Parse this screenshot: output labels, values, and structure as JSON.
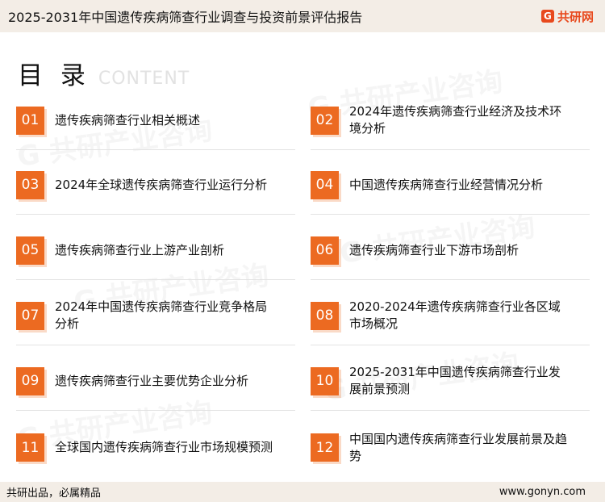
{
  "header": {
    "title": "2025-2031年中国遗传疾病筛查行业调查与投资前景评估报告",
    "brand_mark": "G",
    "brand_name": "共研网"
  },
  "toc": {
    "heading": "目 录",
    "heading_sub": "CONTENT",
    "items": [
      {
        "num": "01",
        "label": "遗传疾病筛查行业相关概述"
      },
      {
        "num": "02",
        "label": "2024年遗传疾病筛查行业经济及技术环境分析"
      },
      {
        "num": "03",
        "label": "2024年全球遗传疾病筛查行业运行分析"
      },
      {
        "num": "04",
        "label": "中国遗传疾病筛查行业经营情况分析"
      },
      {
        "num": "05",
        "label": "遗传疾病筛查行业上游产业剖析"
      },
      {
        "num": "06",
        "label": "遗传疾病筛查行业下游市场剖析"
      },
      {
        "num": "07",
        "label": "2024年中国遗传疾病筛查行业竞争格局分析"
      },
      {
        "num": "08",
        "label": "2020-2024年遗传疾病筛查行业各区域市场概况"
      },
      {
        "num": "09",
        "label": "遗传疾病筛查行业主要优势企业分析"
      },
      {
        "num": "10",
        "label": "2025-2031年中国遗传疾病筛查行业发展前景预测"
      },
      {
        "num": "11",
        "label": "全球国内遗传疾病筛查行业市场规模预测"
      },
      {
        "num": "12",
        "label": "中国国内遗传疾病筛查行业发展前景及趋势"
      }
    ]
  },
  "footer": {
    "slogan": "共研出品，必属精品",
    "url": "www.gonyn.com"
  },
  "watermark_text": "G 共研产业咨询",
  "colors": {
    "accent": "#ec6a21",
    "bar": "#f3ede6"
  }
}
